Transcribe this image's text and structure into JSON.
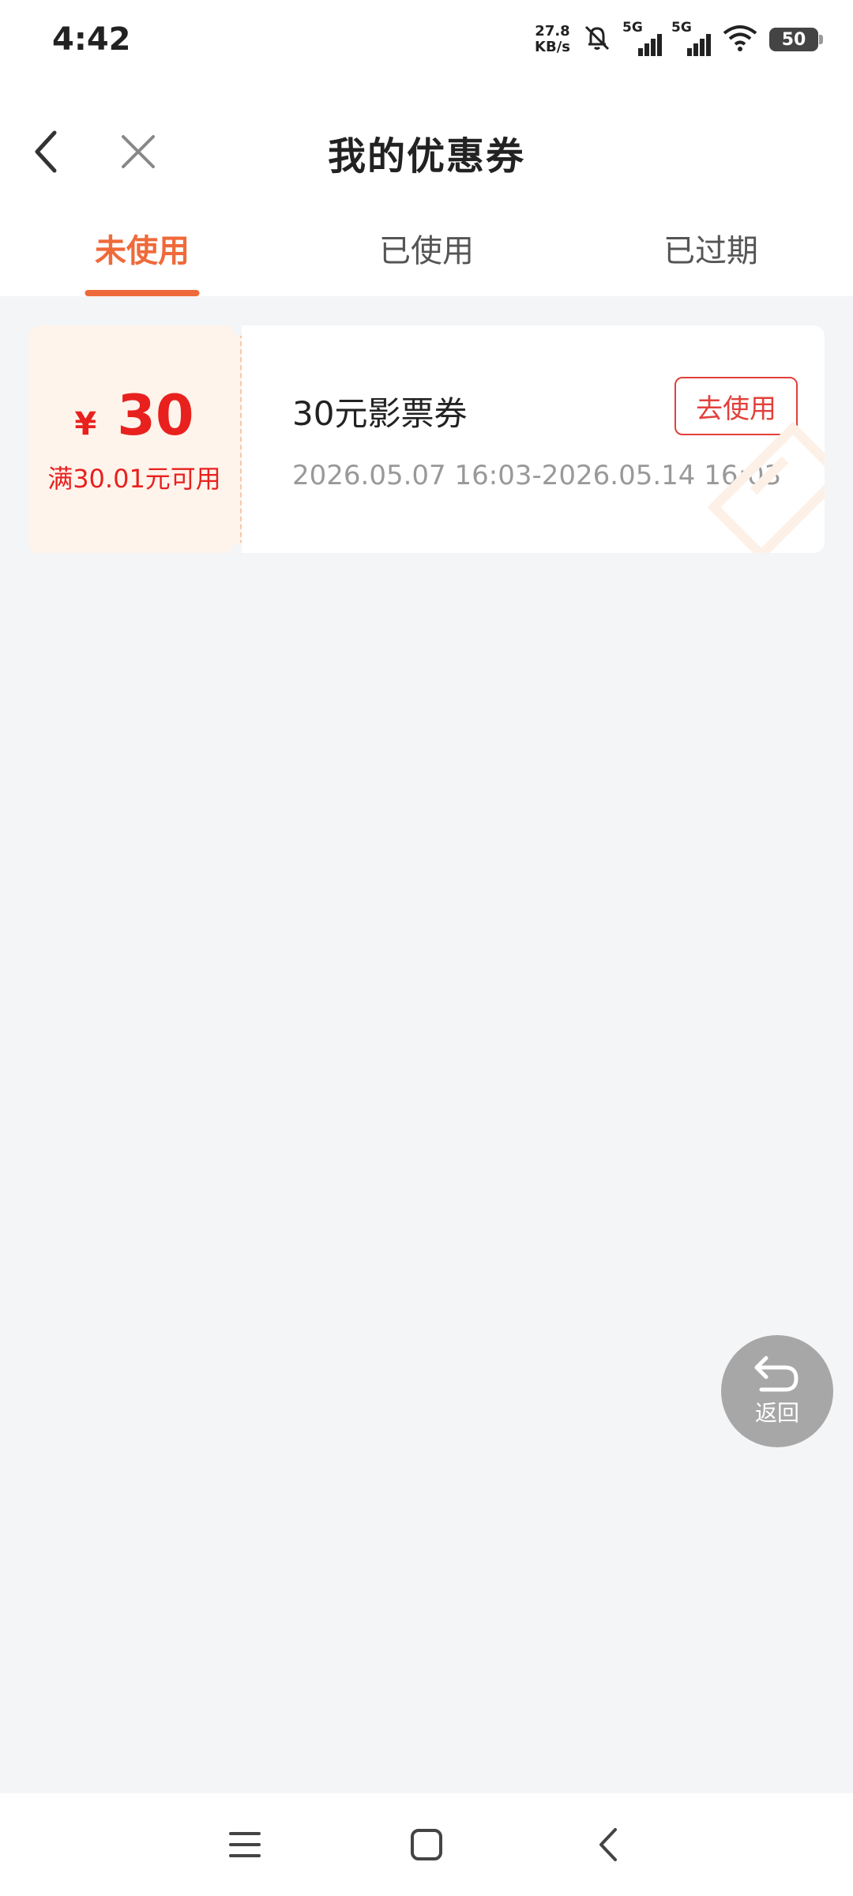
{
  "status_bar": {
    "time": "4:42",
    "net_speed_value": "27.8",
    "net_speed_unit": "KB/s",
    "signal1_label": "5G",
    "signal2_label": "5G",
    "battery": "50"
  },
  "header": {
    "title": "我的优惠券"
  },
  "tabs": [
    {
      "label": "未使用",
      "active": true
    },
    {
      "label": "已使用",
      "active": false
    },
    {
      "label": "已过期",
      "active": false
    }
  ],
  "coupon": {
    "currency": "¥",
    "amount": "30",
    "condition": "满30.01元可用",
    "name": "30元影票券",
    "validity": "2026.05.07 16:03-2026.05.14 16:03",
    "action_label": "去使用"
  },
  "float_button": {
    "label": "返回"
  },
  "colors": {
    "accent": "#ef6a3a",
    "price_red": "#e8211e",
    "coupon_bg": "#fff4ec",
    "page_bg": "#f4f5f7"
  }
}
